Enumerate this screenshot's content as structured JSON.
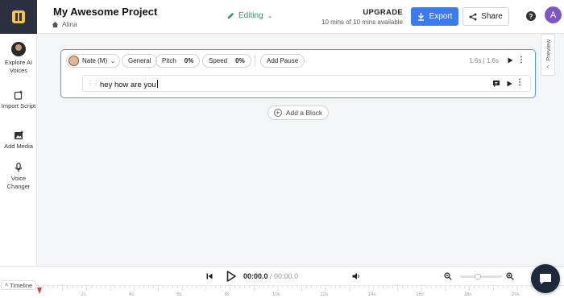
{
  "header": {
    "project_title": "My Awesome Project",
    "breadcrumb": "Alina",
    "mode": "Editing",
    "upgrade_title": "UPGRADE",
    "upgrade_sub": "10 mins of 10 mins available",
    "export_label": "Export",
    "share_label": "Share",
    "help_label": "?",
    "avatar_letter": "A",
    "accent_color": "#3a7bf0",
    "avatar_color": "#7e57c2"
  },
  "sidebar": {
    "items": [
      {
        "label": "Explore AI Voices",
        "icon": "voice-avatar-icon"
      },
      {
        "label": "Import Script",
        "icon": "import-script-icon"
      },
      {
        "label": "Add Media",
        "icon": "add-media-icon"
      },
      {
        "label": "Voice Changer",
        "icon": "voice-changer-icon"
      }
    ]
  },
  "editor": {
    "voice": "Nate (M)",
    "style": "General",
    "pitch_label": "Pitch",
    "pitch_value": "0%",
    "speed_label": "Speed",
    "speed_value": "0%",
    "add_pause": "Add Pause",
    "duration": "1.6s | 1.6s",
    "block_text": "hey how are you",
    "add_block": "Add a Block"
  },
  "preview_tab": "Preview",
  "player": {
    "current_time": "00:00.0",
    "separator": " / ",
    "total_time": "00:00.0"
  },
  "timeline": {
    "label": "Timeline",
    "ticks": [
      "2s",
      "4s",
      "6s",
      "8s",
      "10s",
      "12s",
      "14s",
      "16s",
      "18s",
      "20s"
    ]
  }
}
